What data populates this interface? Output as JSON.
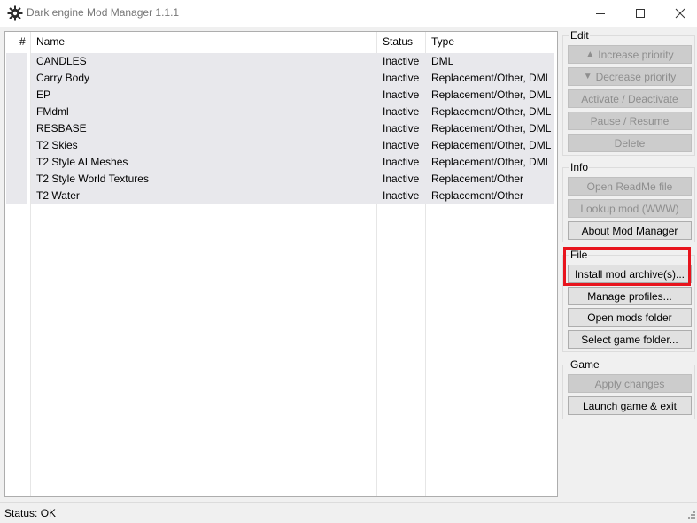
{
  "window": {
    "title": "Dark engine Mod Manager 1.1.1",
    "icon": "gear-icon"
  },
  "table": {
    "headers": [
      "#",
      "Name",
      "Status",
      "Type"
    ],
    "rows": [
      {
        "name": "CANDLES",
        "status": "Inactive",
        "type": "DML"
      },
      {
        "name": "Carry Body",
        "status": "Inactive",
        "type": "Replacement/Other, DML"
      },
      {
        "name": "EP",
        "status": "Inactive",
        "type": "Replacement/Other, DML"
      },
      {
        "name": "FMdml",
        "status": "Inactive",
        "type": "Replacement/Other, DML"
      },
      {
        "name": "RESBASE",
        "status": "Inactive",
        "type": "Replacement/Other, DML"
      },
      {
        "name": "T2 Skies",
        "status": "Inactive",
        "type": "Replacement/Other, DML"
      },
      {
        "name": "T2 Style AI Meshes",
        "status": "Inactive",
        "type": "Replacement/Other, DML"
      },
      {
        "name": "T2 Style World Textures",
        "status": "Inactive",
        "type": "Replacement/Other"
      },
      {
        "name": "T2 Water",
        "status": "Inactive",
        "type": "Replacement/Other"
      }
    ]
  },
  "edit": {
    "title": "Edit",
    "increase": "Increase priority",
    "decrease": "Decrease priority",
    "activate": "Activate / Deactivate",
    "pause": "Pause / Resume",
    "delete": "Delete"
  },
  "info": {
    "title": "Info",
    "readme": "Open ReadMe file",
    "lookup": "Lookup mod (WWW)",
    "about": "About Mod Manager"
  },
  "file": {
    "title": "File",
    "install": "Install mod archive(s)...",
    "profiles": "Manage profiles...",
    "open_folder": "Open mods folder",
    "select_folder": "Select game folder..."
  },
  "game": {
    "title": "Game",
    "apply": "Apply changes",
    "launch": "Launch game & exit"
  },
  "status": {
    "text": "Status: OK"
  },
  "colors": {
    "highlight": "#e8141d",
    "row_selection": "#e8e8ec"
  }
}
